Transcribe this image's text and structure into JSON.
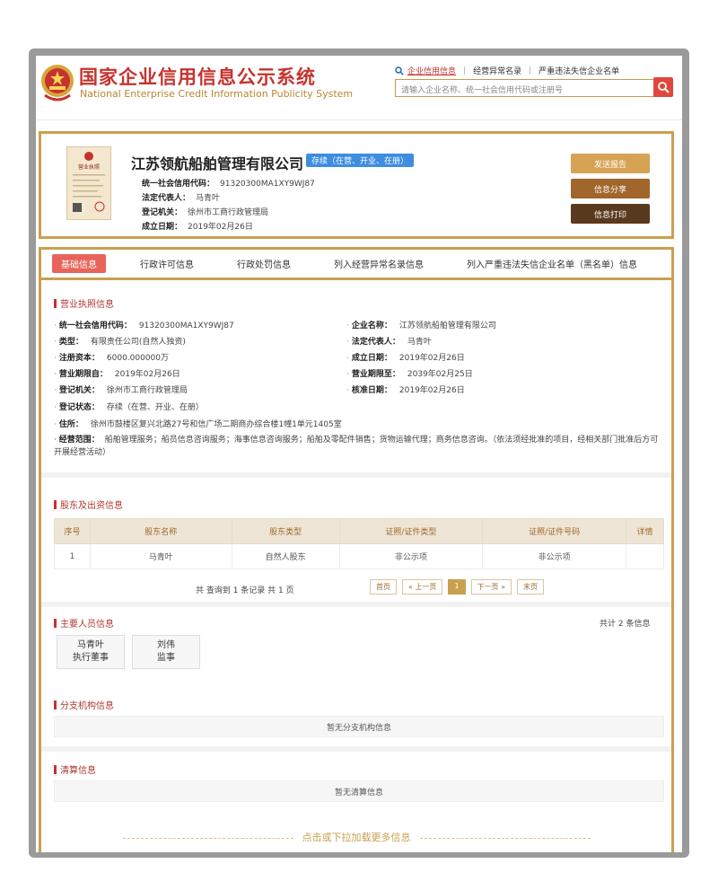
{
  "header": {
    "title_cn": "国家企业信用信息公示系统",
    "title_en": "National Enterprise Credit Information Publicity System",
    "nav": [
      "企业信用信息",
      "经营异常名录",
      "严重违法失信企业名单"
    ],
    "search_placeholder": "请输入企业名称、统一社会信用代码或注册号"
  },
  "company": {
    "name": "江苏领航船舶管理有限公司",
    "status": "存续（在营、开业、在册）",
    "fields": [
      {
        "label": "统一社会信用代码：",
        "value": "91320300MA1XY9WJ87"
      },
      {
        "label": "法定代表人：",
        "value": "马青叶"
      },
      {
        "label": "登记机关：",
        "value": "徐州市工商行政管理局"
      },
      {
        "label": "成立日期：",
        "value": "2019年02月26日"
      }
    ],
    "buttons": {
      "report": "发送报告",
      "share": "信息分享",
      "print": "信息打印"
    },
    "license_text": "营业执照"
  },
  "tabs": [
    "基础信息",
    "行政许可信息",
    "行政处罚信息",
    "列入经营异常名录信息",
    "列入严重违法失信企业名单（黑名单）信息"
  ],
  "business_license": {
    "title": "营业执照信息",
    "left": [
      {
        "label": "统一社会信用代码：",
        "value": "91320300MA1XY9WJ87"
      },
      {
        "label": "类型：",
        "value": "有限责任公司(自然人独资)"
      },
      {
        "label": "注册资本：",
        "value": "6000.000000万"
      },
      {
        "label": "营业期限自：",
        "value": "2019年02月26日"
      },
      {
        "label": "登记机关：",
        "value": "徐州市工商行政管理局"
      },
      {
        "label": "登记状态：",
        "value": "存续（在营、开业、在册）"
      },
      {
        "label": "住所：",
        "value": "徐州市鼓楼区复兴北路27号和信广场二期商办综合楼1幢1单元1405室"
      }
    ],
    "right": [
      {
        "label": "企业名称：",
        "value": "江苏领航船舶管理有限公司"
      },
      {
        "label": "法定代表人：",
        "value": "马青叶"
      },
      {
        "label": "成立日期：",
        "value": "2019年02月26日"
      },
      {
        "label": "营业期限至：",
        "value": "2039年02月25日"
      },
      {
        "label": "核准日期：",
        "value": "2019年02月26日"
      }
    ],
    "scope_label": "经营范围：",
    "scope_value": "船舶管理服务；船员信息咨询服务；海事信息咨询服务；船舶及零配件销售；货物运输代理；商务信息咨询。（依法须经批准的项目，经相关部门批准后方可开展经营活动）"
  },
  "shareholders": {
    "title": "股东及出资信息",
    "columns": [
      "序号",
      "股东名称",
      "股东类型",
      "证照/证件类型",
      "证照/证件号码",
      "详情"
    ],
    "rows": [
      [
        "1",
        "马青叶",
        "自然人股东",
        "非公示项",
        "非公示项",
        ""
      ]
    ],
    "summary": "共 查询到 1 条记录 共 1 页",
    "pager": [
      "首页",
      "« 上一页",
      "1",
      "下一页 »",
      "末页"
    ]
  },
  "personnel": {
    "title": "主要人员信息",
    "count": "共计 2 条信息",
    "people": [
      {
        "name": "马青叶",
        "role": "执行董事"
      },
      {
        "name": "刘伟",
        "role": "监事"
      }
    ]
  },
  "branches": {
    "title": "分支机构信息",
    "empty": "暂无分支机构信息"
  },
  "liquidation": {
    "title": "清算信息",
    "empty": "暂无清算信息"
  },
  "load_more": "点击或下拉加载更多信息",
  "colors": {
    "brand_red": "#c6322d",
    "gold": "#c9a04f",
    "badge_blue": "#3d8de0"
  }
}
